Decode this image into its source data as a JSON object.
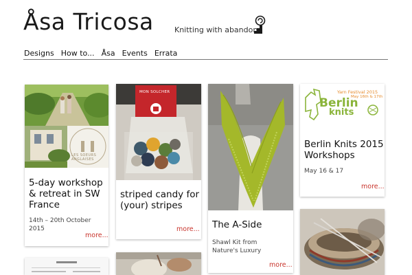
{
  "header": {
    "site_title": "Åsa Tricosa",
    "tagline": "Knitting with abandon",
    "logo_icon": "spiral-stair-logo-icon"
  },
  "nav": {
    "items": [
      {
        "label": "Designs"
      },
      {
        "label": "How to..."
      },
      {
        "label": "Åsa"
      },
      {
        "label": "Events"
      },
      {
        "label": "Errata"
      }
    ]
  },
  "posts": [
    {
      "title": "5-day workshop & retreat in SW France",
      "meta": "14th – 20th October 2015",
      "more": "more...",
      "image": "garden-path-and-french-house-photo",
      "image_text": "LES SOEURS ANGLAISES"
    },
    {
      "title": "striped candy for (your) stripes",
      "more": "more...",
      "image": "yarn-minis-in-bag-photo",
      "image_text": "MON SOLCHER"
    },
    {
      "title": "The A-Side",
      "meta": "Shawl Kit from Nature's Luxury",
      "more": "more...",
      "image": "green-lace-shawl-photo"
    },
    {
      "title": "Berlin Knits 2015 Workshops",
      "meta": "May 16 & 17",
      "more": "more...",
      "image": "berlin-knits-logo",
      "image_text": {
        "festival": "Yarn Festival 2015",
        "dates": "May 16th & 17th",
        "brand_line1": "Berlin",
        "brand_line2": "knits"
      }
    }
  ],
  "partial_cards": [
    {
      "image": "bowl-with-knitting-needles-photo"
    },
    {
      "image": "document-screenshot-thumbnail"
    },
    {
      "image": "knitted-sweater-detail-photo"
    }
  ],
  "colors": {
    "more_link": "#c8332b",
    "shawl_green": "#a4b82a",
    "berlin_green": "#8ab43a",
    "berlin_orange": "#e58a2a"
  }
}
